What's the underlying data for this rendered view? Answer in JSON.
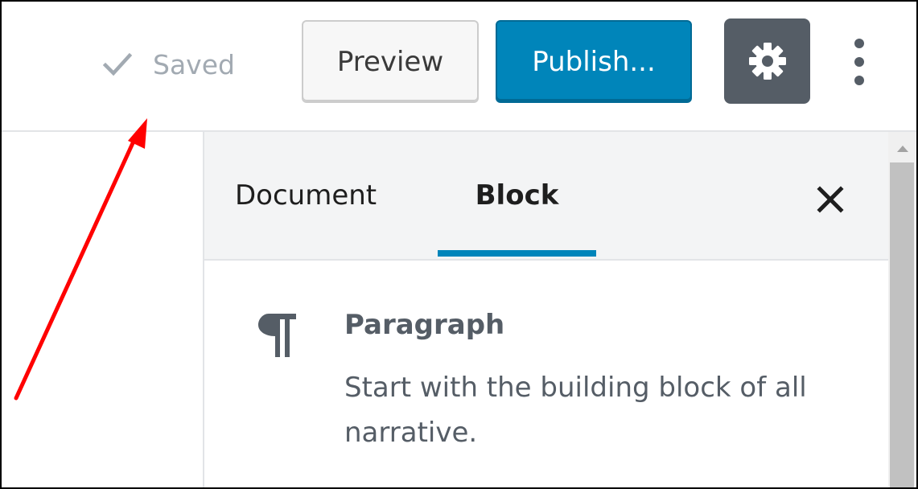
{
  "toolbar": {
    "saved_label": "Saved",
    "preview_label": "Preview",
    "publish_label": "Publish..."
  },
  "sidebar": {
    "tabs": [
      {
        "label": "Document",
        "active": false
      },
      {
        "label": "Block",
        "active": true
      }
    ],
    "block": {
      "title": "Paragraph",
      "description": "Start with the building block of all narrative."
    }
  },
  "icons": {
    "saved": "check-icon",
    "settings": "gear-icon",
    "more": "more-vertical-icon",
    "close": "close-icon",
    "block": "paragraph-icon"
  },
  "colors": {
    "accent": "#0085ba",
    "settings_button": "#555d66",
    "annotation_arrow": "#ff0000"
  }
}
